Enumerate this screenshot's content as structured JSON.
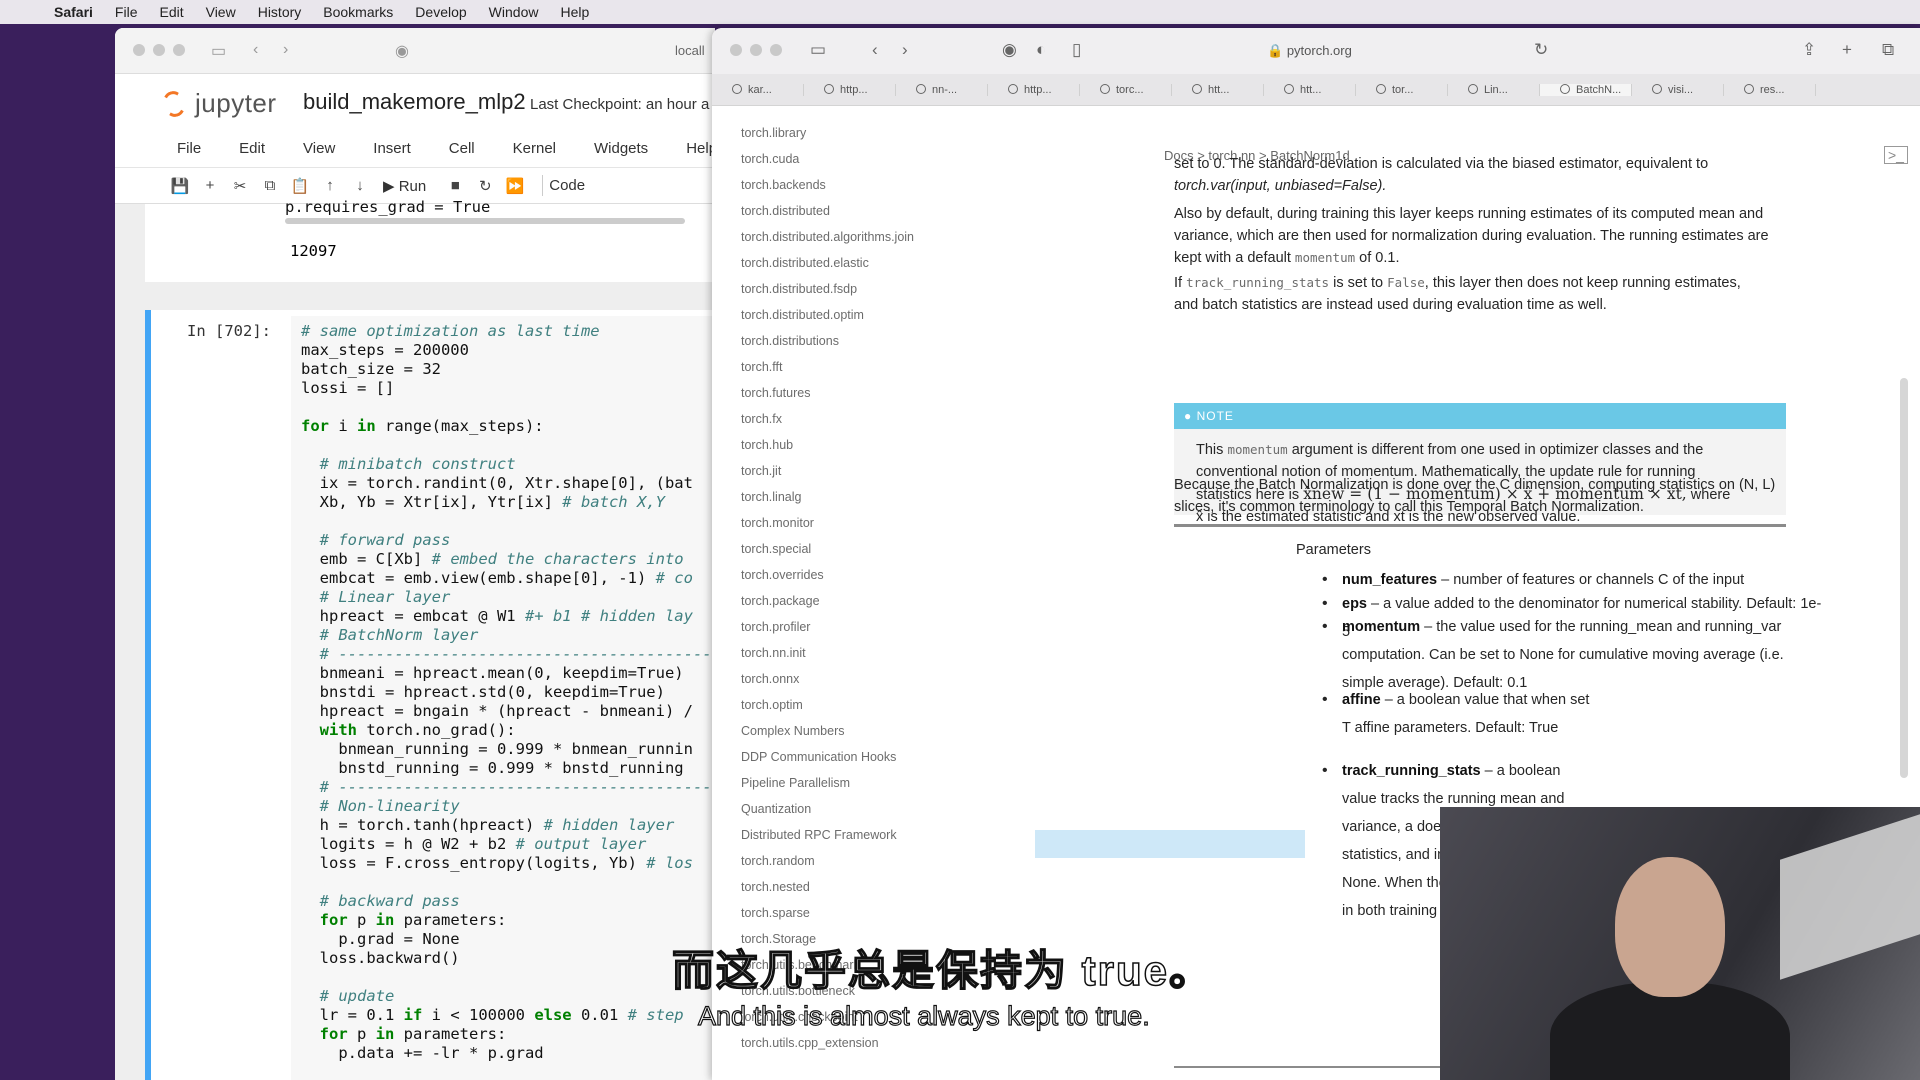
{
  "menubar": {
    "app": "Safari",
    "items": [
      "File",
      "Edit",
      "View",
      "History",
      "Bookmarks",
      "Develop",
      "Window",
      "Help"
    ]
  },
  "jupyter": {
    "url": "locall",
    "logo_text": "jupyter",
    "notebook_name": "build_makemore_mlp2",
    "checkpoint": "Last Checkpoint: an hour a",
    "menu": [
      "File",
      "Edit",
      "View",
      "Insert",
      "Cell",
      "Kernel",
      "Widgets",
      "Help"
    ],
    "toolbar": {
      "run_label": "Run",
      "cell_type": "Code"
    },
    "prev_cell_code": "p.requires_grad = True",
    "prev_output": "12097",
    "prompt": "In [702]:"
  },
  "safari": {
    "url": "pytorch.org",
    "tabs": [
      "kar...",
      "http...",
      "nn-...",
      "http...",
      "torc...",
      "htt...",
      "htt...",
      "tor...",
      "Lin...",
      "BatchN...",
      "visi...",
      "res..."
    ]
  },
  "sidebar": [
    "torch.library",
    "torch.cuda",
    "torch.backends",
    "torch.distributed",
    "torch.distributed.algorithms.join",
    "torch.distributed.elastic",
    "torch.distributed.fsdp",
    "torch.distributed.optim",
    "torch.distributions",
    "torch.fft",
    "torch.futures",
    "torch.fx",
    "torch.hub",
    "torch.jit",
    "torch.linalg",
    "torch.monitor",
    "torch.special",
    "torch.overrides",
    "torch.package",
    "torch.profiler",
    "torch.nn.init",
    "torch.onnx",
    "torch.optim",
    "Complex Numbers",
    "DDP Communication Hooks",
    "Pipeline Parallelism",
    "Quantization",
    "Distributed RPC Framework",
    "torch.random",
    "torch.nested",
    "torch.sparse",
    "torch.Storage",
    "torch.utils.benchmark",
    "torch.utils.bottleneck",
    "torch.utils.checkpoint",
    "torch.utils.cpp_extension"
  ],
  "docs": {
    "breadcrumb": "Docs > torch.nn > BatchNorm1d",
    "p1a": "set to 0. The standard-deviation is calculated via the biased estimator, equivalent to",
    "p1b": "torch.var(input, unbiased=False).",
    "p2a": "Also by default, during training this layer keeps running estimates of its computed mean and",
    "p2b": "variance, which are then used for normalization during evaluation. The running estimates are",
    "p2c_pre": "kept with a default",
    "p2c_code": "momentum",
    "p2c_post": "of 0.1.",
    "p3_pre": "If",
    "p3_code1": "track_running_stats",
    "p3_mid": "is set to",
    "p3_code2": "False",
    "p3_post": ", this layer then does not keep running estimates,",
    "p3b": "and batch statistics are instead used during evaluation time as well.",
    "note_title": "NOTE",
    "note_l1_pre": "This",
    "note_l1_code": "momentum",
    "note_l1_post": "argument is different from one used in optimizer classes and the",
    "note_l2": "conventional notion of momentum. Mathematically, the update rule for running",
    "note_l3_pre": "statistics here is",
    "note_formula": "x̂new = (1 − momentum) × x̂ + momentum × xt,",
    "note_l3_post": "where",
    "note_l4": "x̂ is the estimated statistic and xt is the new observed value.",
    "p4a": "Because the Batch Normalization is done over the C dimension, computing statistics on (N, L)",
    "p4b": "slices, it's common terminology to call this Temporal Batch Normalization.",
    "params_title": "Parameters",
    "params": [
      {
        "name": "num_features",
        "desc": " – number of features or channels C of the input"
      },
      {
        "name": "eps",
        "desc": " – a value added to the denominator for numerical stability. Default: 1e-5"
      },
      {
        "name": "momentum",
        "desc": " – the value used for the running_mean and running_var computation. Can be set to None for cumulative moving average (i.e. simple average). Default: 0.1"
      },
      {
        "name": "affine",
        "desc": " – a boolean value that when set T affine parameters. Default: True"
      },
      {
        "name": "track_running_stats",
        "desc": " – a boolean value tracks the running mean and variance, a does not track such statistics, and initia and running_var as None. When thes uses batch statistics. in both training an"
      }
    ]
  },
  "subtitles": {
    "cn": "而这几乎总是保持为 true。",
    "en": "And this is almost always kept to true."
  }
}
